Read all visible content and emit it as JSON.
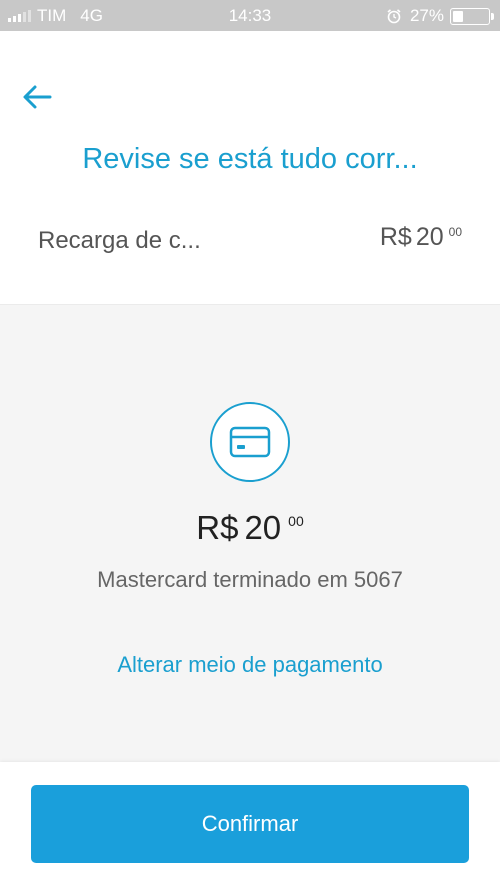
{
  "status_bar": {
    "carrier": "TIM",
    "network": "4G",
    "time": "14:33",
    "battery": "27%",
    "signal_bars": 3
  },
  "header": {
    "title": "Revise se está tudo corr..."
  },
  "item": {
    "label": "Recarga de c...",
    "currency": "R$",
    "amount": "20",
    "cents": "00"
  },
  "payment": {
    "currency": "R$",
    "amount": "20",
    "cents": "00",
    "card_description": "Mastercard terminado em 5067",
    "change_link": "Alterar meio de pagamento"
  },
  "footer": {
    "confirm_label": "Confirmar"
  },
  "icons": {
    "back": "arrow-left-icon",
    "card": "credit-card-icon",
    "alarm": "alarm-icon"
  },
  "colors": {
    "accent": "#1a9fcf",
    "button": "#1a9fdb",
    "status_bar": "#c8c8c8",
    "section_bg": "#f5f5f5"
  }
}
